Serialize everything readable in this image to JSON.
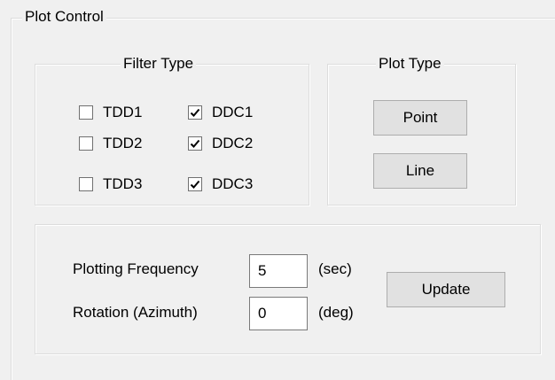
{
  "plot_control": {
    "title": "Plot Control",
    "filter_type": {
      "title": "Filter Type",
      "options": [
        {
          "label": "TDD1",
          "checked": false
        },
        {
          "label": "TDD2",
          "checked": false
        },
        {
          "label": "TDD3",
          "checked": false
        },
        {
          "label": "DDC1",
          "checked": true
        },
        {
          "label": "DDC2",
          "checked": true
        },
        {
          "label": "DDC3",
          "checked": true
        }
      ]
    },
    "plot_type": {
      "title": "Plot Type",
      "point_label": "Point",
      "line_label": "Line"
    },
    "settings": {
      "frequency_label": "Plotting Frequency",
      "frequency_value": "5",
      "frequency_unit": "(sec)",
      "rotation_label": "Rotation (Azimuth)",
      "rotation_value": "0",
      "rotation_unit": "(deg)",
      "update_label": "Update"
    }
  }
}
